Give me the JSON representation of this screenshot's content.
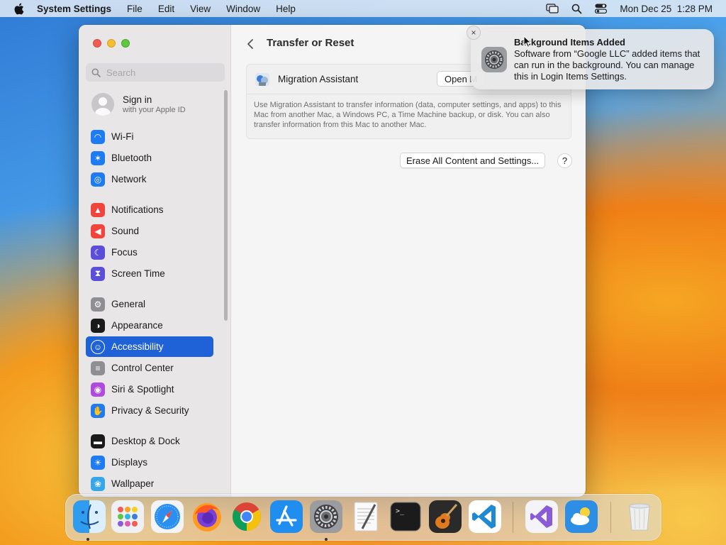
{
  "menubar": {
    "app_name": "System Settings",
    "menus": [
      "File",
      "Edit",
      "View",
      "Window",
      "Help"
    ],
    "datetime": "Mon Dec 25  1:28 PM"
  },
  "sidebar": {
    "search_placeholder": "Search",
    "signin": {
      "title": "Sign in",
      "subtitle": "with your Apple ID"
    },
    "items": [
      {
        "label": "Wi-Fi",
        "icon": "wifi-icon",
        "color": "#1e7bf2"
      },
      {
        "label": "Bluetooth",
        "icon": "bluetooth-icon",
        "color": "#1e7bf2"
      },
      {
        "label": "Network",
        "icon": "globe-icon",
        "color": "#1e7bf2"
      },
      {
        "label": "Notifications",
        "icon": "bell-icon",
        "color": "#f0443c"
      },
      {
        "label": "Sound",
        "icon": "speaker-icon",
        "color": "#f0443c"
      },
      {
        "label": "Focus",
        "icon": "moon-icon",
        "color": "#5b4fd9"
      },
      {
        "label": "Screen Time",
        "icon": "hourglass-icon",
        "color": "#5b4fd9"
      },
      {
        "label": "General",
        "icon": "gear-icon",
        "color": "#8e8e93"
      },
      {
        "label": "Appearance",
        "icon": "appearance-icon",
        "color": "#1a1a1a"
      },
      {
        "label": "Accessibility",
        "icon": "accessibility-icon",
        "color": "#1e7bf2"
      },
      {
        "label": "Control Center",
        "icon": "control-center-icon",
        "color": "#8e8e93"
      },
      {
        "label": "Siri & Spotlight",
        "icon": "siri-icon",
        "color": "#b04adf"
      },
      {
        "label": "Privacy & Security",
        "icon": "hand-icon",
        "color": "#1e7bf2"
      },
      {
        "label": "Desktop & Dock",
        "icon": "dock-icon",
        "color": "#1a1a1a"
      },
      {
        "label": "Displays",
        "icon": "sun-icon",
        "color": "#1e7bf2"
      },
      {
        "label": "Wallpaper",
        "icon": "wallpaper-icon",
        "color": "#37a6e8"
      }
    ],
    "active_item": "Accessibility"
  },
  "content": {
    "title": "Transfer or Reset",
    "migration": {
      "label": "Migration Assistant",
      "open_button": "Open M",
      "description": "Use Migration Assistant to transfer information (data, computer settings, and apps) to this Mac from another Mac, a Windows PC, a Time Machine backup, or disk. You can also transfer information from this Mac to another Mac."
    },
    "erase_button": "Erase All Content and Settings...",
    "help_button": "?"
  },
  "notification": {
    "title": "Background Items Added",
    "body": "Software from “Google LLC” added items that can run in the background. You can manage this in Login Items Settings.",
    "close": "×"
  },
  "dock": {
    "apps": [
      "Finder",
      "Launchpad",
      "Safari",
      "Firefox",
      "Chrome",
      "App Store",
      "System Settings",
      "TextEdit",
      "Terminal",
      "GarageBand",
      "Visual Studio Code",
      "Visual Studio",
      "Weather",
      "Trash"
    ],
    "running": [
      "Finder",
      "System Settings"
    ]
  }
}
